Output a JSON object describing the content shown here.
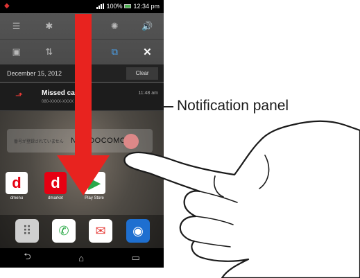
{
  "status_bar": {
    "battery": "100%",
    "time": "12:34 pm",
    "app_icon": "docomo-icon",
    "signal_icon": "signal-bars-icon",
    "battery_icon": "battery-icon"
  },
  "quick_settings": {
    "row1": [
      {
        "icon": "wifi-icon",
        "glyph": "☰",
        "state": "off"
      },
      {
        "icon": "bluetooth-icon",
        "glyph": "✱",
        "state": "off"
      },
      {
        "icon": "placeholder-icon",
        "glyph": "",
        "state": "off"
      },
      {
        "icon": "brightness-icon",
        "glyph": "✺",
        "state": "off"
      },
      {
        "icon": "volume-icon",
        "glyph": "🔊",
        "state": "active"
      }
    ],
    "row2": [
      {
        "icon": "nfc-icon",
        "glyph": "▣",
        "state": "off"
      },
      {
        "icon": "data-icon",
        "glyph": "⇅",
        "state": "off"
      },
      {
        "icon": "placeholder-icon",
        "glyph": "",
        "state": "off"
      },
      {
        "icon": "screen-rotate-icon",
        "glyph": "⧉",
        "state": "active"
      },
      {
        "icon": "settings-tools-icon",
        "glyph": "✕",
        "state": "white"
      }
    ]
  },
  "notification_header": {
    "date": "December 15, 2012",
    "clear_label": "Clear"
  },
  "notification": {
    "title": "Missed cal",
    "subtitle": "080-XXXX-XXXX",
    "time": "11:48 am",
    "icon": "missed-call-icon"
  },
  "home": {
    "operator_name": "NTT DOCOMO",
    "operator_tag": "番号が登録されていません",
    "apps": [
      {
        "name": "dmenu",
        "label": "dmenu",
        "glyph": "d",
        "bg": "#ffffff",
        "fg": "#e60012"
      },
      {
        "name": "dmarket",
        "label": "dmarket",
        "glyph": "d",
        "bg": "#e60012",
        "fg": "#ffffff"
      },
      {
        "name": "play-store",
        "label": "Play Store",
        "glyph": "▶",
        "bg": "#ffffff",
        "fg": "#2aa84a"
      }
    ],
    "dock": [
      {
        "name": "app-drawer",
        "glyph": "⠿",
        "bg": "#cfcfcf",
        "fg": "#555555"
      },
      {
        "name": "phone",
        "glyph": "✆",
        "bg": "#ffffff",
        "fg": "#27a844"
      },
      {
        "name": "email",
        "glyph": "✉",
        "bg": "#ffffff",
        "fg": "#e53935"
      },
      {
        "name": "browser",
        "glyph": "◉",
        "bg": "#1e6fd0",
        "fg": "#ffffff"
      }
    ],
    "nav": [
      {
        "name": "back-icon",
        "glyph": "⮌"
      },
      {
        "name": "home-icon",
        "glyph": "⌂"
      },
      {
        "name": "recent-apps-icon",
        "glyph": "▭"
      }
    ]
  },
  "annotation": {
    "label": "Notification panel"
  },
  "colors": {
    "arrow": "#e8231f",
    "accent_blue": "#4aa3f0",
    "docomo_red": "#e60012"
  }
}
